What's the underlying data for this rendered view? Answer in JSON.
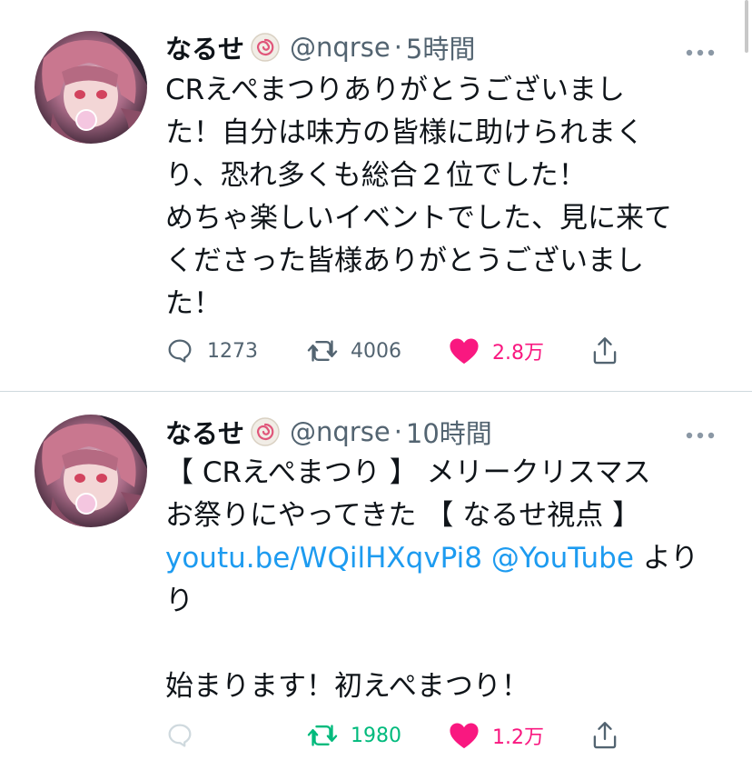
{
  "colors": {
    "link": "#1d9bf0",
    "like": "#f91880",
    "retweet": "#00ba7c",
    "secondary_text": "#536471"
  },
  "tweets": [
    {
      "author_name": "なるせ",
      "badge_icon": "swirl-emoji-icon",
      "handle": "@nqrse",
      "separator": "·",
      "time": "5時間",
      "text_lines": [
        "CRえぺまつりありがとうございまし",
        "た！自分は味方の皆様に助けられまく",
        "り、恐れ多くも総合２位でした！",
        "めちゃ楽しいイベントでした、見に来て",
        "くださった皆様ありがとうございまし",
        "た！"
      ],
      "reply_count": "1273",
      "retweet_count": "4006",
      "like_count": "2.8万",
      "liked": true,
      "retweeted": false
    },
    {
      "author_name": "なるせ",
      "badge_icon": "swirl-emoji-icon",
      "handle": "@nqrse",
      "separator": "·",
      "time": "10時間",
      "text_line1": "【 CRえぺまつり 】 メリークリスマス",
      "text_line2": "お祭りにやってきた 【 なるせ視点 】",
      "link_url": "youtu.be/WQilHXqvPi8",
      "mention": "@YouTube",
      "text_after_mention": " より",
      "text_line4": "り",
      "text_line5": "",
      "text_line6": "始まります！初えぺまつり！",
      "reply_count": "",
      "retweet_count": "1980",
      "like_count": "1.2万",
      "liked": true,
      "retweeted": true
    }
  ]
}
